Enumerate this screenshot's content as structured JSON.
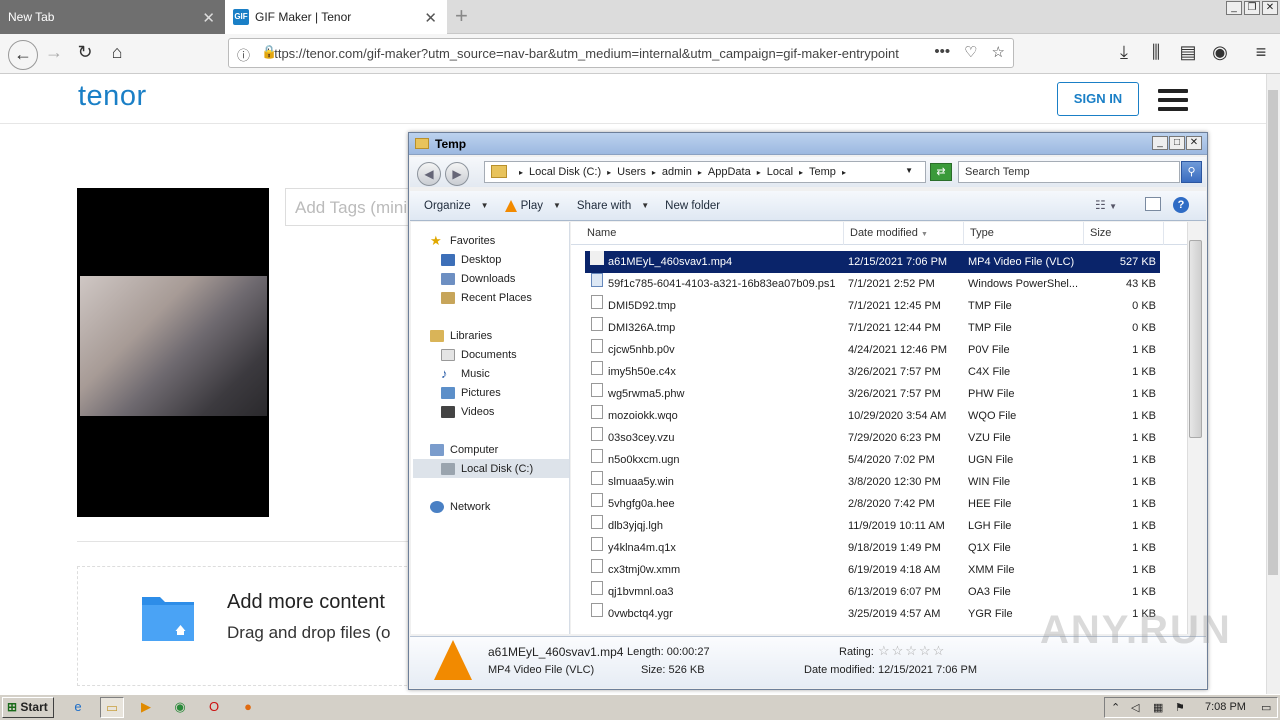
{
  "browser": {
    "tabs": [
      {
        "label": "New Tab"
      },
      {
        "label": "GIF Maker | Tenor",
        "favicon": "GIF"
      }
    ],
    "url": "https://tenor.com/gif-maker?utm_source=nav-bar&utm_medium=internal&utm_campaign=gif-maker-entrypoint"
  },
  "tenor": {
    "logo": "tenor",
    "signin_label": "SIGN IN",
    "tags_placeholder": "Add Tags (mini",
    "add_more_title": "Add more content",
    "add_more_sub": "Drag and drop files (o"
  },
  "explorer": {
    "title": "Temp",
    "breadcrumb": [
      "Local Disk (C:)",
      "Users",
      "admin",
      "AppData",
      "Local",
      "Temp"
    ],
    "search_placeholder": "Search Temp",
    "commands": {
      "organize": "Organize",
      "play": "Play",
      "share": "Share with",
      "new_folder": "New folder"
    },
    "nav": {
      "favorites": "Favorites",
      "desktop": "Desktop",
      "downloads": "Downloads",
      "recent": "Recent Places",
      "libraries": "Libraries",
      "documents": "Documents",
      "music": "Music",
      "pictures": "Pictures",
      "videos": "Videos",
      "computer": "Computer",
      "localdisk": "Local Disk (C:)",
      "network": "Network"
    },
    "columns": {
      "name": "Name",
      "date": "Date modified",
      "type": "Type",
      "size": "Size"
    },
    "files": [
      {
        "name": "a61MEyL_460svav1.mp4",
        "date": "12/15/2021 7:06 PM",
        "type": "MP4 Video File (VLC)",
        "size": "527 KB"
      },
      {
        "name": "59f1c785-6041-4103-a321-16b83ea07b09.ps1",
        "date": "7/1/2021 2:52 PM",
        "type": "Windows PowerShel...",
        "size": "43 KB"
      },
      {
        "name": "DMI5D92.tmp",
        "date": "7/1/2021 12:45 PM",
        "type": "TMP File",
        "size": "0 KB"
      },
      {
        "name": "DMI326A.tmp",
        "date": "7/1/2021 12:44 PM",
        "type": "TMP File",
        "size": "0 KB"
      },
      {
        "name": "cjcw5nhb.p0v",
        "date": "4/24/2021 12:46 PM",
        "type": "P0V File",
        "size": "1 KB"
      },
      {
        "name": "imy5h50e.c4x",
        "date": "3/26/2021 7:57 PM",
        "type": "C4X File",
        "size": "1 KB"
      },
      {
        "name": "wg5rwma5.phw",
        "date": "3/26/2021 7:57 PM",
        "type": "PHW File",
        "size": "1 KB"
      },
      {
        "name": "mozoiokk.wqo",
        "date": "10/29/2020 3:54 AM",
        "type": "WQO File",
        "size": "1 KB"
      },
      {
        "name": "03so3cey.vzu",
        "date": "7/29/2020 6:23 PM",
        "type": "VZU File",
        "size": "1 KB"
      },
      {
        "name": "n5o0kxcm.ugn",
        "date": "5/4/2020 7:02 PM",
        "type": "UGN File",
        "size": "1 KB"
      },
      {
        "name": "slmuaa5y.win",
        "date": "3/8/2020 12:30 PM",
        "type": "WIN File",
        "size": "1 KB"
      },
      {
        "name": "5vhgfg0a.hee",
        "date": "2/8/2020 7:42 PM",
        "type": "HEE File",
        "size": "1 KB"
      },
      {
        "name": "dlb3yjqj.lgh",
        "date": "11/9/2019 10:11 AM",
        "type": "LGH File",
        "size": "1 KB"
      },
      {
        "name": "y4klna4m.q1x",
        "date": "9/18/2019 1:49 PM",
        "type": "Q1X File",
        "size": "1 KB"
      },
      {
        "name": "cx3tmj0w.xmm",
        "date": "6/19/2019 4:18 AM",
        "type": "XMM File",
        "size": "1 KB"
      },
      {
        "name": "qj1bvmnl.oa3",
        "date": "6/13/2019 6:07 PM",
        "type": "OA3 File",
        "size": "1 KB"
      },
      {
        "name": "0vwbctq4.ygr",
        "date": "3/25/2019 4:57 AM",
        "type": "YGR File",
        "size": "1 KB"
      }
    ],
    "details": {
      "name": "a61MEyL_460svav1.mp4",
      "length": "Length: 00:00:27",
      "type": "MP4 Video File (VLC)",
      "size": "Size: 526 KB",
      "rating": "Rating:",
      "date": "Date modified: 12/15/2021 7:06 PM"
    }
  },
  "taskbar": {
    "start": "Start",
    "time": "7:08 PM"
  },
  "watermark": "ANY.RUN",
  "colors": {
    "tenor_blue": "#1a7fc6",
    "selection": "#0a246a",
    "vlc_orange": "#f28a00"
  }
}
